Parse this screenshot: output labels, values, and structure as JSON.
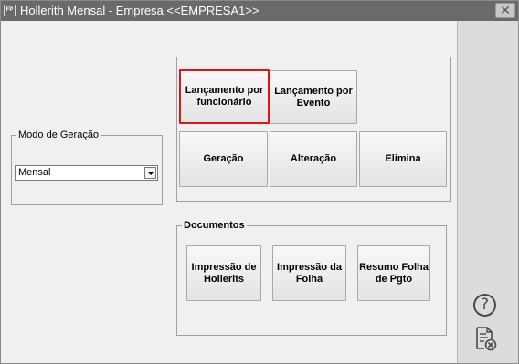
{
  "window": {
    "icon_text": "FP",
    "title": "Hollerith Mensal - Empresa <<EMPRESA1>>",
    "close_label": "✕"
  },
  "modo": {
    "legend": "Modo de Geração",
    "selected_value": "Mensal"
  },
  "actions": {
    "lancamento_funcionario": "Lançamento por\nfuncionário",
    "lancamento_evento": "Lançamento por\nEvento",
    "geracao": "Geração",
    "alteracao": "Alteração",
    "elimina": "Elimina"
  },
  "documentos": {
    "legend": "Documentos",
    "impressao_hollerits": "Impressão de\nHollerits",
    "impressao_folha": "Impressão da\nFolha",
    "resumo_folha": "Resumo Folha\nde Pgto"
  },
  "sidebar": {
    "help_glyph": "?"
  },
  "colors": {
    "titlebar": "#6a6a6a",
    "selected_border": "#e0151b",
    "panel": "#dcdcdc"
  }
}
